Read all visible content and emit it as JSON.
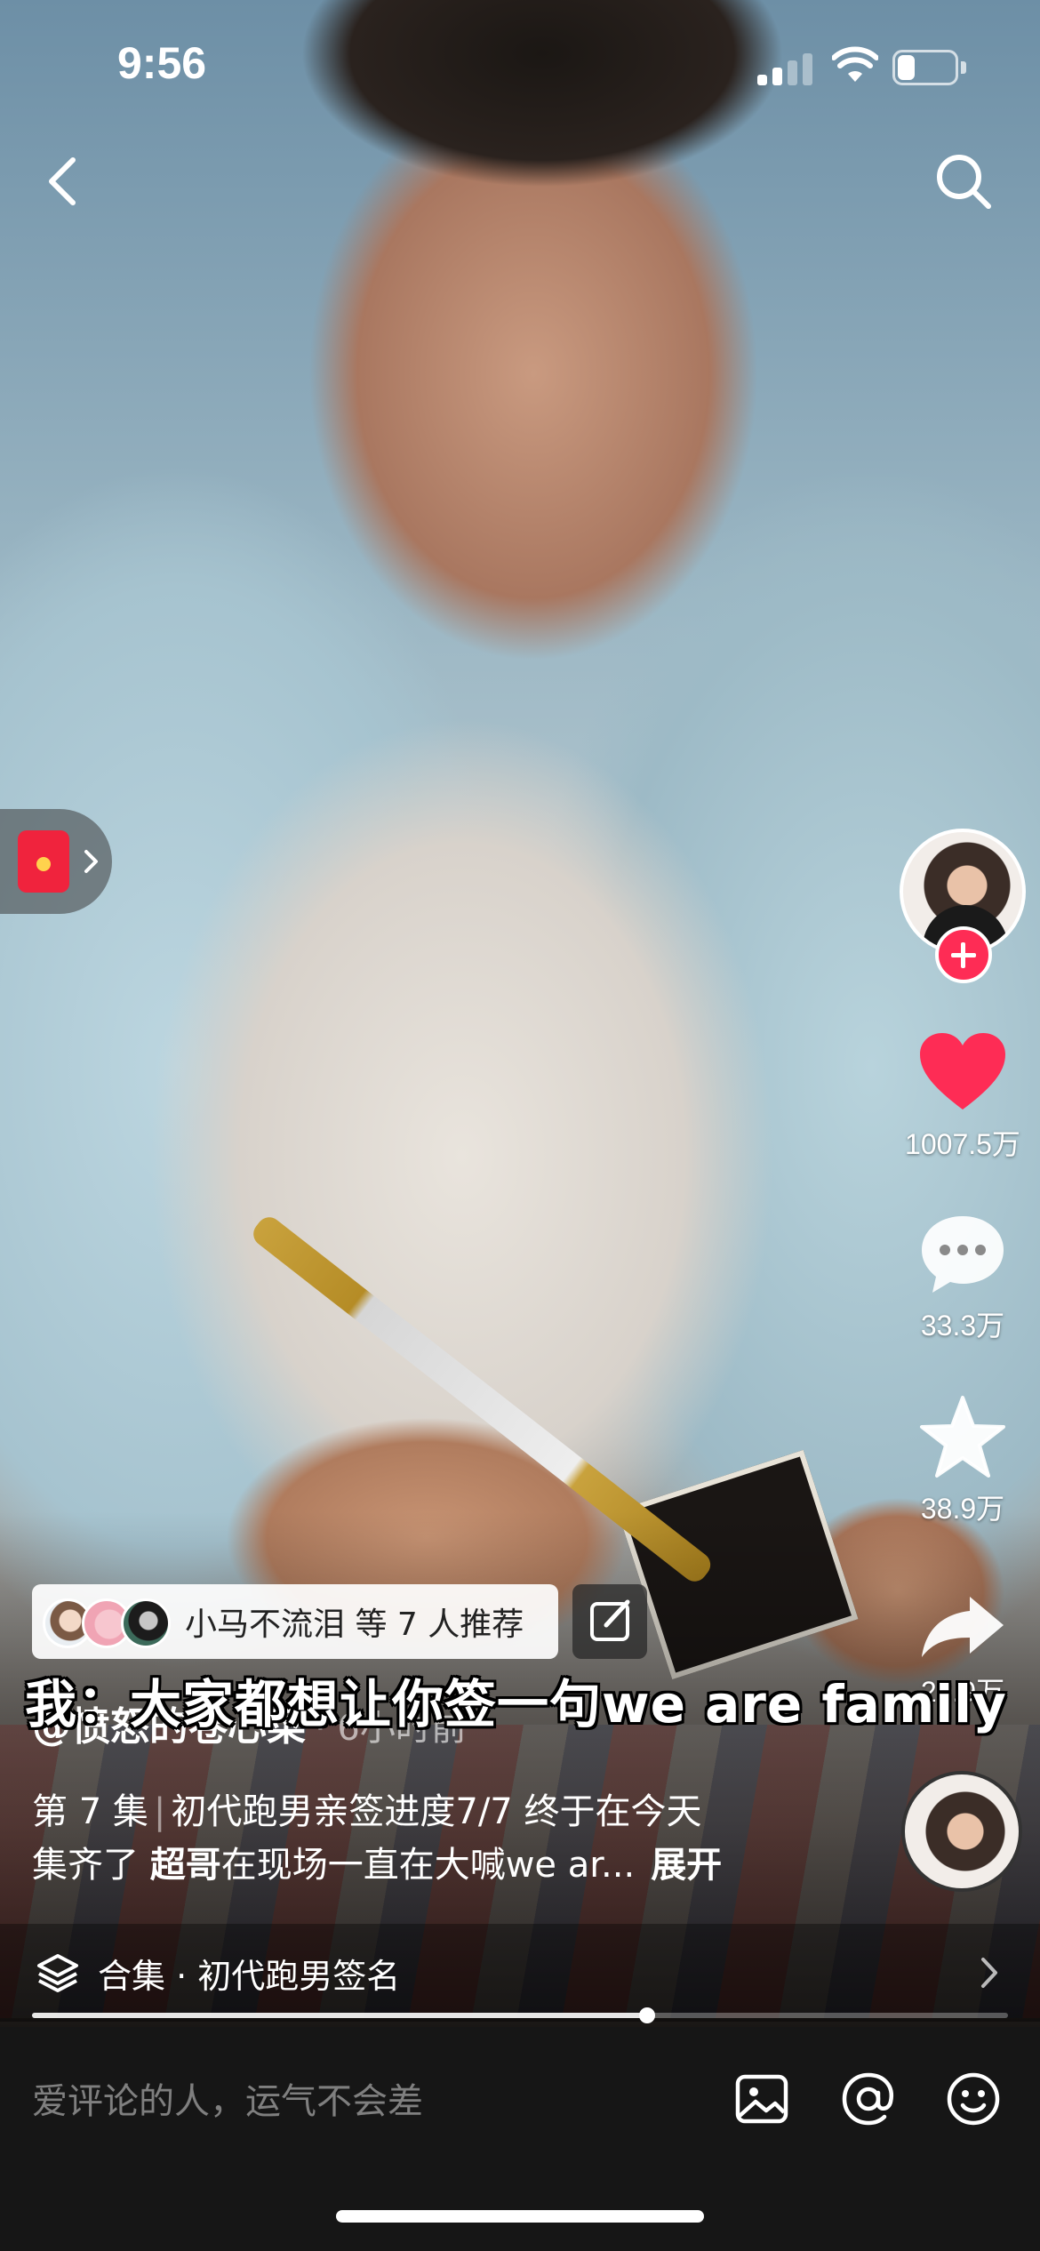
{
  "status_bar": {
    "time": "9:56",
    "battery_level": 0.3
  },
  "nav": {
    "back_icon": "chevron-left-icon",
    "search_icon": "search-icon"
  },
  "sidebar": {
    "like_count": "1007.5万",
    "comment_count": "33.3万",
    "favorite_count": "38.9万",
    "share_count": "28.9万",
    "colors": {
      "like": "#fe2c55",
      "follow": "#fe2c55"
    }
  },
  "video": {
    "caption": "我：大家都想让你签一句we are family",
    "recommend_text": "小马不流泪 等 7 人推荐",
    "author": "@愤怒的卷心菜",
    "post_time": "· 6小时前",
    "episode": "第 7 集",
    "description_line1": "初代跑男亲签进度7/7 终于在今天",
    "description_line2_pre": "集齐了 ",
    "mention": "超哥",
    "description_line2_post": "在现场一直在大喊we ar...",
    "expand_label": "展开",
    "collection_label": "合集 · 初代跑男签名",
    "progress": 0.63
  },
  "comment_bar": {
    "placeholder": "爱评论的人，运气不会差",
    "image_icon": "image-icon",
    "mention_icon": "at-icon",
    "emoji_icon": "emoji-icon"
  }
}
